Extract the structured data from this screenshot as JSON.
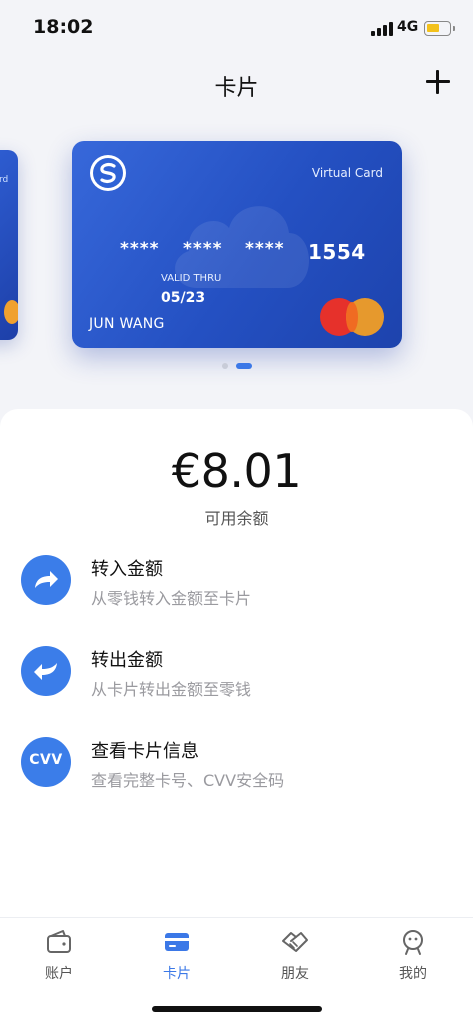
{
  "status": {
    "time": "18:02",
    "network": "4G"
  },
  "header": {
    "title": "卡片",
    "add_icon": "plus-icon"
  },
  "card": {
    "type_label": "Virtual Card",
    "number_masked": [
      "****",
      "****",
      "****"
    ],
    "last4": "1554",
    "valid_label": "VALID THRU",
    "valid_date": "05/23",
    "holder": "JUN WANG",
    "brand_colors": {
      "card": "#2450c2",
      "mc_red": "#e6312b",
      "mc_yellow": "#f59f22"
    }
  },
  "side_card": {
    "type_fragment": "rd"
  },
  "pager": {
    "count": 2,
    "active_index": 1
  },
  "balance": {
    "amount": "€8.01",
    "label": "可用余额"
  },
  "actions": [
    {
      "title": "转入金额",
      "subtitle": "从零钱转入金额至卡片",
      "icon": "arrow-in-icon"
    },
    {
      "title": "转出金额",
      "subtitle": "从卡片转出金额至零钱",
      "icon": "arrow-out-icon"
    },
    {
      "title": "查看卡片信息",
      "subtitle": "查看完整卡号、CVV安全码",
      "icon": "cvv-icon",
      "icon_text": "CVV"
    }
  ],
  "tabs": [
    {
      "label": "账户",
      "icon": "wallet-icon",
      "active": false
    },
    {
      "label": "卡片",
      "icon": "card-icon",
      "active": true
    },
    {
      "label": "朋友",
      "icon": "handshake-icon",
      "active": false
    },
    {
      "label": "我的",
      "icon": "face-icon",
      "active": false
    }
  ],
  "colors": {
    "accent": "#3b78e7",
    "background": "#f3f4f8"
  }
}
